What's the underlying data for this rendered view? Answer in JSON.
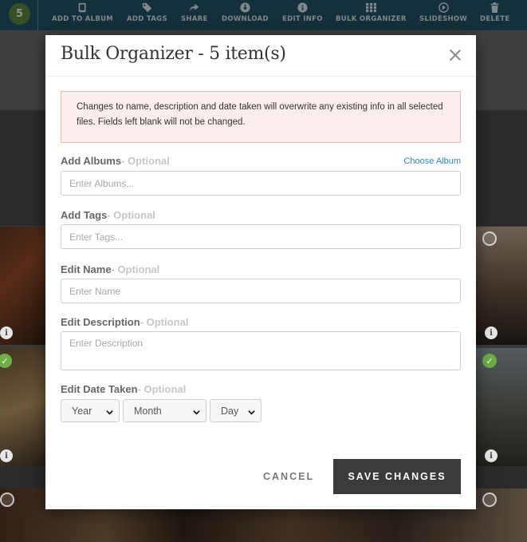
{
  "toolbar": {
    "count": "5",
    "actions": [
      {
        "label": "ADD TO ALBUM",
        "icon": "book-icon"
      },
      {
        "label": "ADD TAGS",
        "icon": "tag-icon"
      },
      {
        "label": "SHARE",
        "icon": "share-icon"
      },
      {
        "label": "DOWNLOAD",
        "icon": "download-icon"
      },
      {
        "label": "EDIT INFO",
        "icon": "info-icon"
      },
      {
        "label": "BULK ORGANIZER",
        "icon": "grid-icon"
      },
      {
        "label": "SLIDESHOW",
        "icon": "play-icon"
      },
      {
        "label": "DELETE",
        "icon": "trash-icon"
      }
    ]
  },
  "modal": {
    "title": "Bulk Organizer - 5 item(s)",
    "notice": "Changes to name, description and date taken will overwrite any existing info in all selected files. Fields left blank will not be changed.",
    "fields": {
      "albums": {
        "label": "Add Albums",
        "optional": "- Optional",
        "placeholder": "Enter Albums...",
        "link": "Choose Album"
      },
      "tags": {
        "label": "Add Tags",
        "optional": "- Optional",
        "placeholder": "Enter Tags..."
      },
      "name": {
        "label": "Edit Name",
        "optional": "- Optional",
        "placeholder": "Enter Name"
      },
      "description": {
        "label": "Edit Description",
        "optional": "- Optional",
        "placeholder": "Enter Description"
      },
      "date": {
        "label": "Edit Date Taken",
        "optional": "- Optional",
        "year": "Year",
        "month": "Month",
        "day": "Day"
      }
    },
    "cancel_label": "CANCEL",
    "save_label": "SAVE CHANGES"
  },
  "colors": {
    "toolbar": "#1f4a5c",
    "badge": "#557a3c",
    "notice_bg": "#fbeeed",
    "notice_border": "#ebb9b6",
    "link": "#2f88c0",
    "save_button": "#3d3b3a",
    "check": "#6fae48"
  }
}
